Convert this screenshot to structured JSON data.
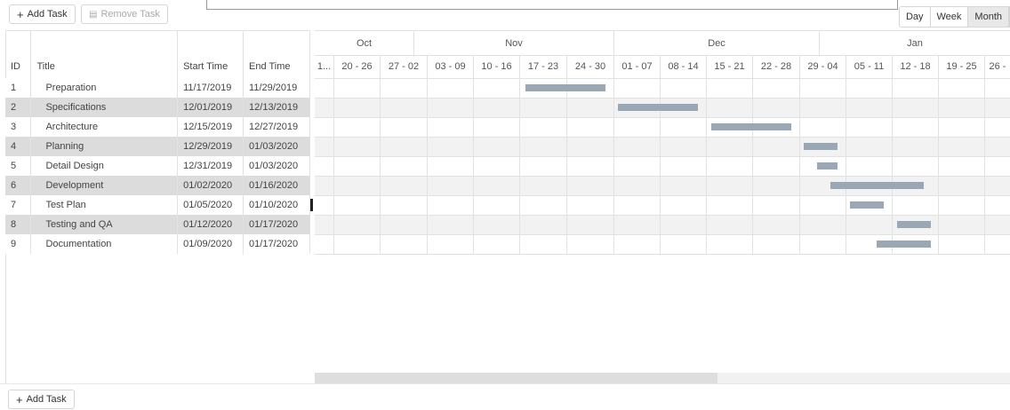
{
  "toolbar": {
    "add_task_label": "Add Task",
    "remove_task_label": "Remove Task",
    "views": [
      {
        "label": "Day",
        "active": false
      },
      {
        "label": "Week",
        "active": false
      },
      {
        "label": "Month",
        "active": true
      }
    ]
  },
  "grid": {
    "columns": {
      "id": "ID",
      "title": "Title",
      "start": "Start Time",
      "end": "End Time"
    },
    "rows": [
      {
        "id": "1",
        "title": "Preparation",
        "start": "11/17/2019",
        "end": "11/29/2019"
      },
      {
        "id": "2",
        "title": "Specifications",
        "start": "12/01/2019",
        "end": "12/13/2019"
      },
      {
        "id": "3",
        "title": "Architecture",
        "start": "12/15/2019",
        "end": "12/27/2019"
      },
      {
        "id": "4",
        "title": "Planning",
        "start": "12/29/2019",
        "end": "01/03/2020"
      },
      {
        "id": "5",
        "title": "Detail Design",
        "start": "12/31/2019",
        "end": "01/03/2020"
      },
      {
        "id": "6",
        "title": "Development",
        "start": "01/02/2020",
        "end": "01/16/2020"
      },
      {
        "id": "7",
        "title": "Test Plan",
        "start": "01/05/2020",
        "end": "01/10/2020"
      },
      {
        "id": "8",
        "title": "Testing and QA",
        "start": "01/12/2020",
        "end": "01/17/2020"
      },
      {
        "id": "9",
        "title": "Documentation",
        "start": "01/09/2020",
        "end": "01/17/2020"
      }
    ]
  },
  "chart": {
    "months": [
      "Oct",
      "Nov",
      "Dec",
      "Jan"
    ],
    "weeks": [
      "1...",
      "20 - 26",
      "27 - 02",
      "03 - 09",
      "10 - 16",
      "17 - 23",
      "24 - 30",
      "01 - 07",
      "08 - 14",
      "15 - 21",
      "22 - 28",
      "29 - 04",
      "05 - 11",
      "12 - 18",
      "19 - 25",
      "26 -"
    ]
  },
  "footer": {
    "add_task_label": "Add Task"
  },
  "colors": {
    "bar": "#9aa7b5",
    "alt_row": "#dcdcdc"
  }
}
